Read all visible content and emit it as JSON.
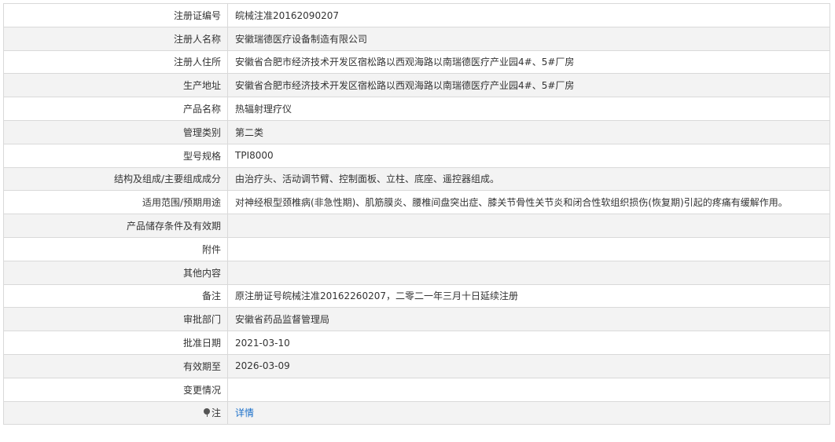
{
  "record": {
    "reg_no": {
      "label": "注册证编号",
      "value": "皖械注准20162090207"
    },
    "registrant_name": {
      "label": "注册人名称",
      "value": "安徽瑞德医疗设备制造有限公司"
    },
    "registrant_address": {
      "label": "注册人住所",
      "value": "安徽省合肥市经济技术开发区宿松路以西观海路以南瑞德医疗产业园4#、5#厂房"
    },
    "production_address": {
      "label": "生产地址",
      "value": "安徽省合肥市经济技术开发区宿松路以西观海路以南瑞德医疗产业园4#、5#厂房"
    },
    "product_name": {
      "label": "产品名称",
      "value": "热辐射理疗仪"
    },
    "management_class": {
      "label": "管理类别",
      "value": "第二类"
    },
    "model_spec": {
      "label": "型号规格",
      "value": "TPI8000"
    },
    "structure": {
      "label": "结构及组成/主要组成成分",
      "value": "由治疗头、活动调节臂、控制面板、立柱、底座、遥控器组成。"
    },
    "intended_use": {
      "label": "适用范围/预期用途",
      "value": "对神经根型颈椎病(非急性期)、肌筋膜炎、腰椎间盘突出症、膝关节骨性关节炎和闭合性软组织损伤(恢复期)引起的疼痛有缓解作用。"
    },
    "storage": {
      "label": "产品储存条件及有效期",
      "value": ""
    },
    "attachment": {
      "label": "附件",
      "value": ""
    },
    "other": {
      "label": "其他内容",
      "value": ""
    },
    "remarks": {
      "label": "备注",
      "value": "原注册证号皖械注准20162260207，二零二一年三月十日延续注册"
    },
    "approval_dept": {
      "label": "审批部门",
      "value": "安徽省药品监督管理局"
    },
    "approval_date": {
      "label": "批准日期",
      "value": "2021-03-10"
    },
    "valid_until": {
      "label": "有效期至",
      "value": "2026-03-09"
    },
    "changes": {
      "label": "变更情况",
      "value": ""
    },
    "note": {
      "label": "注",
      "icon": "pin-icon",
      "link_text": "详情"
    }
  },
  "colors": {
    "border": "#d9d9d9",
    "row_alt_bg": "#f3f3f3",
    "link": "#1a6fc9",
    "text": "#333333"
  }
}
